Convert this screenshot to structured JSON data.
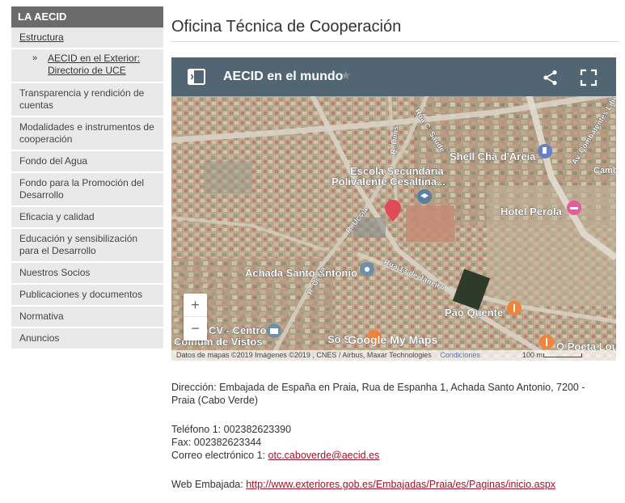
{
  "sidebar": {
    "header": "LA AECID",
    "items": [
      {
        "label": "Estructura",
        "link": true
      },
      {
        "label": "AECID en el Exterior: Directorio de UCE",
        "sub": true,
        "bullet": "»"
      },
      {
        "label": "Transparencia y rendición de cuentas"
      },
      {
        "label": "Modalidades e instrumentos de cooperación"
      },
      {
        "label": "Fondo del Agua"
      },
      {
        "label": "Fondo para la Promoción del Desarrollo"
      },
      {
        "label": "Eficacia y calidad"
      },
      {
        "label": "Educación y sensibilización para el Desarrollo"
      },
      {
        "label": "Nuestros Socios"
      },
      {
        "label": "Publicaciones y documentos"
      },
      {
        "label": "Normativa"
      },
      {
        "label": "Anuncios"
      }
    ]
  },
  "main": {
    "title": "Oficina Técnica de Cooperación"
  },
  "map": {
    "title": "AECID en el mundo",
    "star": "★",
    "zoom_in": "+",
    "zoom_out": "−",
    "labels": {
      "shell": "Shell Chã d'Areia",
      "escola_1": "Escola Secundária",
      "escola_2": "Polivalente Cesaltina...",
      "hotel": "Hotel Perola",
      "achada": "Achada Santo Antonio",
      "pao": "Pão Quente",
      "cv": "CV - Centro",
      "comum": "Comum de Vistos",
      "so": "Só S",
      "poeta": "O Poeta Lou",
      "camb": "Camb",
      "google_logo": "Google My Maps",
      "rua_uccia_1": "R. Uccia",
      "rua_uccia_2": "R. Uccia",
      "rua_13": "Rua 13 de Janeiro",
      "rua_dinis": "R. Dinis",
      "rua_c_saude": "Rua C. Saude",
      "av_combat": "Av. Combatentes Libe"
    },
    "attribution": "Datos de mapas ©2019 Imágenes ©2019 , CNES / Airbus, Maxar Technologies",
    "conditions": "Condiciones",
    "scale": "100 m"
  },
  "contact": {
    "address_label": "Dirección:",
    "address_line1": "Embajada de España en Praia, Rua de Espanha 1, Achada Santo Antonio, 7200 -",
    "address_line2": "Praia (Cabo Verde)",
    "phone_label": "Teléfono 1:",
    "phone": "002382623390",
    "fax_label": "Fax:",
    "fax": "002382623344",
    "email_label": "Correo electrónico 1:",
    "email": "otc.caboverde@aecid.es",
    "web_label": "Web Embajada:",
    "web": "http://www.exteriores.gob.es/Embajadas/Praia/es/Paginas/inicio.aspx"
  },
  "colors": {
    "sidebar_header": "#6b6b6b",
    "sidebar_bg": "#e9e9e9",
    "map_bar": "#516572",
    "link": "#a0152a"
  }
}
